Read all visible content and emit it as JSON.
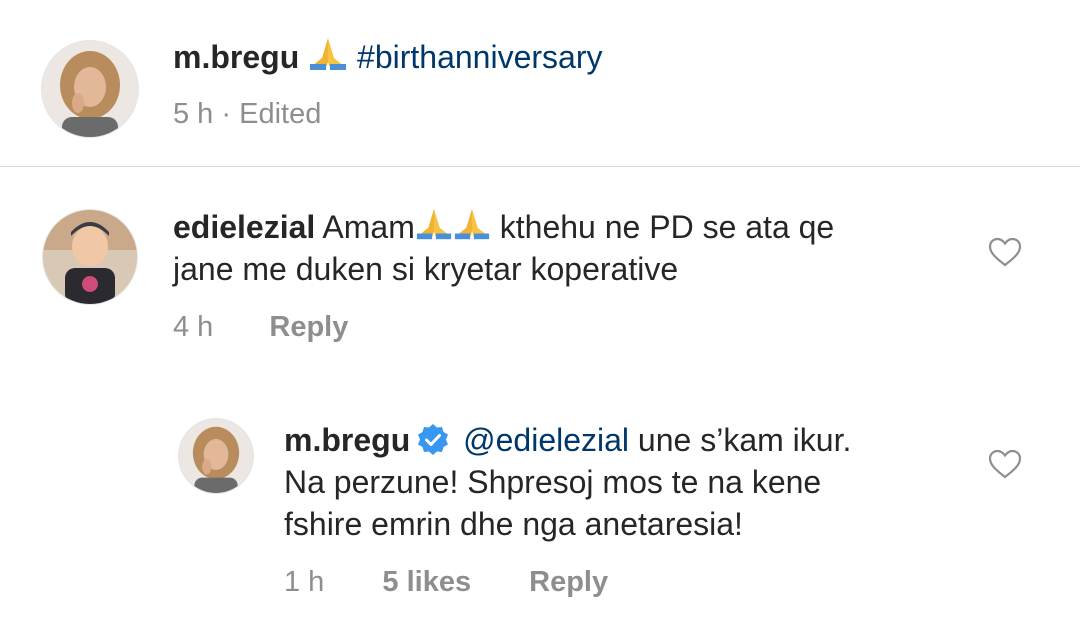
{
  "caption": {
    "username": "m.bregu",
    "hashtag": "#birthanniversary",
    "time": "5 h",
    "separator": "·",
    "edited": "Edited"
  },
  "comment": {
    "username": "edielezial",
    "text_start": "Amam",
    "text_end": "kthehu ne PD se ata qe",
    "text_line2": "jane me duken si kryetar koperative",
    "time": "4 h",
    "reply_label": "Reply"
  },
  "reply": {
    "username": "m.bregu",
    "mention": "@edielezial",
    "text_line1": "une s’kam ikur.",
    "text_line2": "Na perzune! Shpresoj mos te na kene",
    "text_line3": "fshire emrin dhe nga anetaresia!",
    "time": "1 h",
    "likes": "5 likes",
    "reply_label": "Reply"
  },
  "colors": {
    "text": "#262626",
    "muted": "#8e8e8e",
    "link": "#00376b",
    "verified": "#3897f0",
    "divider": "#dbdbdb"
  },
  "icons": [
    "pray-emoji",
    "heart-icon",
    "verified-badge-icon",
    "avatar"
  ]
}
